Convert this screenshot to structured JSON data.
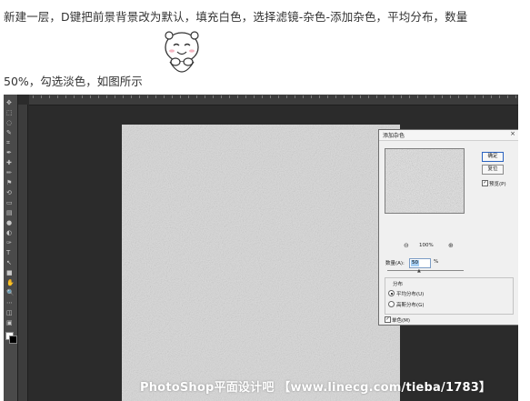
{
  "instructions": {
    "line1": "新建一层，D键把前景背景改为默认，填充白色，选择滤镜-杂色-添加杂色，平均分布，数量",
    "line2": "50%，勾选淡色，如图所示"
  },
  "decor": {
    "emoji_icon": "smiling-bear-emoticon"
  },
  "ps": {
    "tools": [
      "move-icon",
      "marquee-icon",
      "lasso-icon",
      "quick-select-icon",
      "crop-icon",
      "eyedropper-icon",
      "healing-icon",
      "brush-icon",
      "stamp-icon",
      "history-brush-icon",
      "eraser-icon",
      "gradient-icon",
      "blur-icon",
      "dodge-icon",
      "pen-icon",
      "type-icon",
      "path-select-icon",
      "shape-icon",
      "hand-icon",
      "zoom-icon",
      "edit-toolbar-icon",
      "quick-mask-icon",
      "screen-mode-icon"
    ],
    "colors": {
      "workspace": "#2b2b2b",
      "toolbar": "#4a4a4a",
      "canvas": "#d6d6d6",
      "foreground": "#ffffff",
      "background": "#000000"
    }
  },
  "dialog": {
    "title": "添加杂色",
    "close": "×",
    "ok_label": "确定",
    "reset_label": "复位",
    "preview_label": "预览(P)",
    "preview_checked": true,
    "zoom_level": "100%",
    "amount_label": "数量(A):",
    "amount_value": "50",
    "amount_unit": "%",
    "distribution_label": "分布",
    "uniform_label": "平均分布(U)",
    "uniform_selected": true,
    "gaussian_label": "高斯分布(G)",
    "mono_label": "单色(M)",
    "mono_checked": true
  },
  "watermark": "PhotoShop平面设计吧 【www.linecg.com/tieba/1783】"
}
